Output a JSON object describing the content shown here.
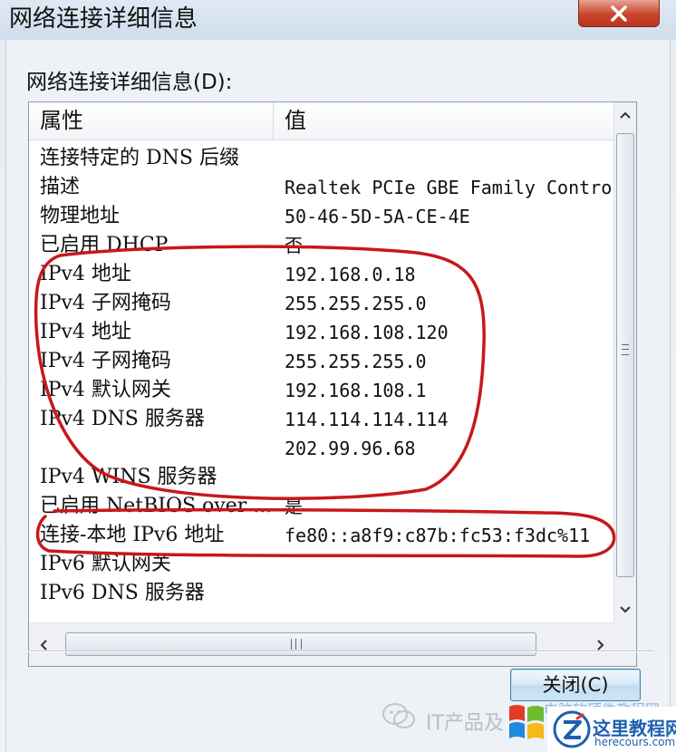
{
  "window": {
    "title": "网络连接详细信息",
    "close_label": "关闭(C)"
  },
  "details": {
    "group_label": "网络连接详细信息(D):",
    "columns": {
      "property": "属性",
      "value": "值"
    },
    "rows": [
      {
        "property": "连接特定的 DNS 后缀",
        "value": ""
      },
      {
        "property": "描述",
        "value": "Realtek PCIe GBE Family Controller"
      },
      {
        "property": "物理地址",
        "value": "50-46-5D-5A-CE-4E"
      },
      {
        "property": "已启用 DHCP",
        "value": "否"
      },
      {
        "property": "IPv4 地址",
        "value": "192.168.0.18"
      },
      {
        "property": "IPv4 子网掩码",
        "value": "255.255.255.0"
      },
      {
        "property": "IPv4 地址",
        "value": "192.168.108.120"
      },
      {
        "property": "IPv4 子网掩码",
        "value": "255.255.255.0"
      },
      {
        "property": "IPv4 默认网关",
        "value": "192.168.108.1"
      },
      {
        "property": "IPv4 DNS 服务器",
        "value": "114.114.114.114"
      },
      {
        "property": "",
        "value": "202.99.96.68"
      },
      {
        "property": "IPv4 WINS 服务器",
        "value": ""
      },
      {
        "property": "已启用 NetBIOS over ...",
        "value": "是"
      },
      {
        "property": "连接-本地 IPv6 地址",
        "value": "fe80::a8f9:c87b:fc53:f3dc%11"
      },
      {
        "property": "IPv6 默认网关",
        "value": ""
      },
      {
        "property": "IPv6 DNS 服务器",
        "value": ""
      }
    ]
  },
  "watermark": {
    "wechat_text": "IT产品及",
    "overlay_text": "电脑软硬件教程网",
    "site_title": "这里教程网",
    "site_url": "herecours.com"
  },
  "colors": {
    "annotation_red": "#c8181a",
    "close_red": "#c9452c",
    "button_border": "#3c7fb1"
  },
  "icons": {
    "close": "close-icon",
    "scroll_up": "scroll-up-arrow-icon",
    "scroll_down": "scroll-down-arrow-icon",
    "scroll_left": "scroll-left-arrow-icon",
    "scroll_right": "scroll-right-arrow-icon"
  }
}
